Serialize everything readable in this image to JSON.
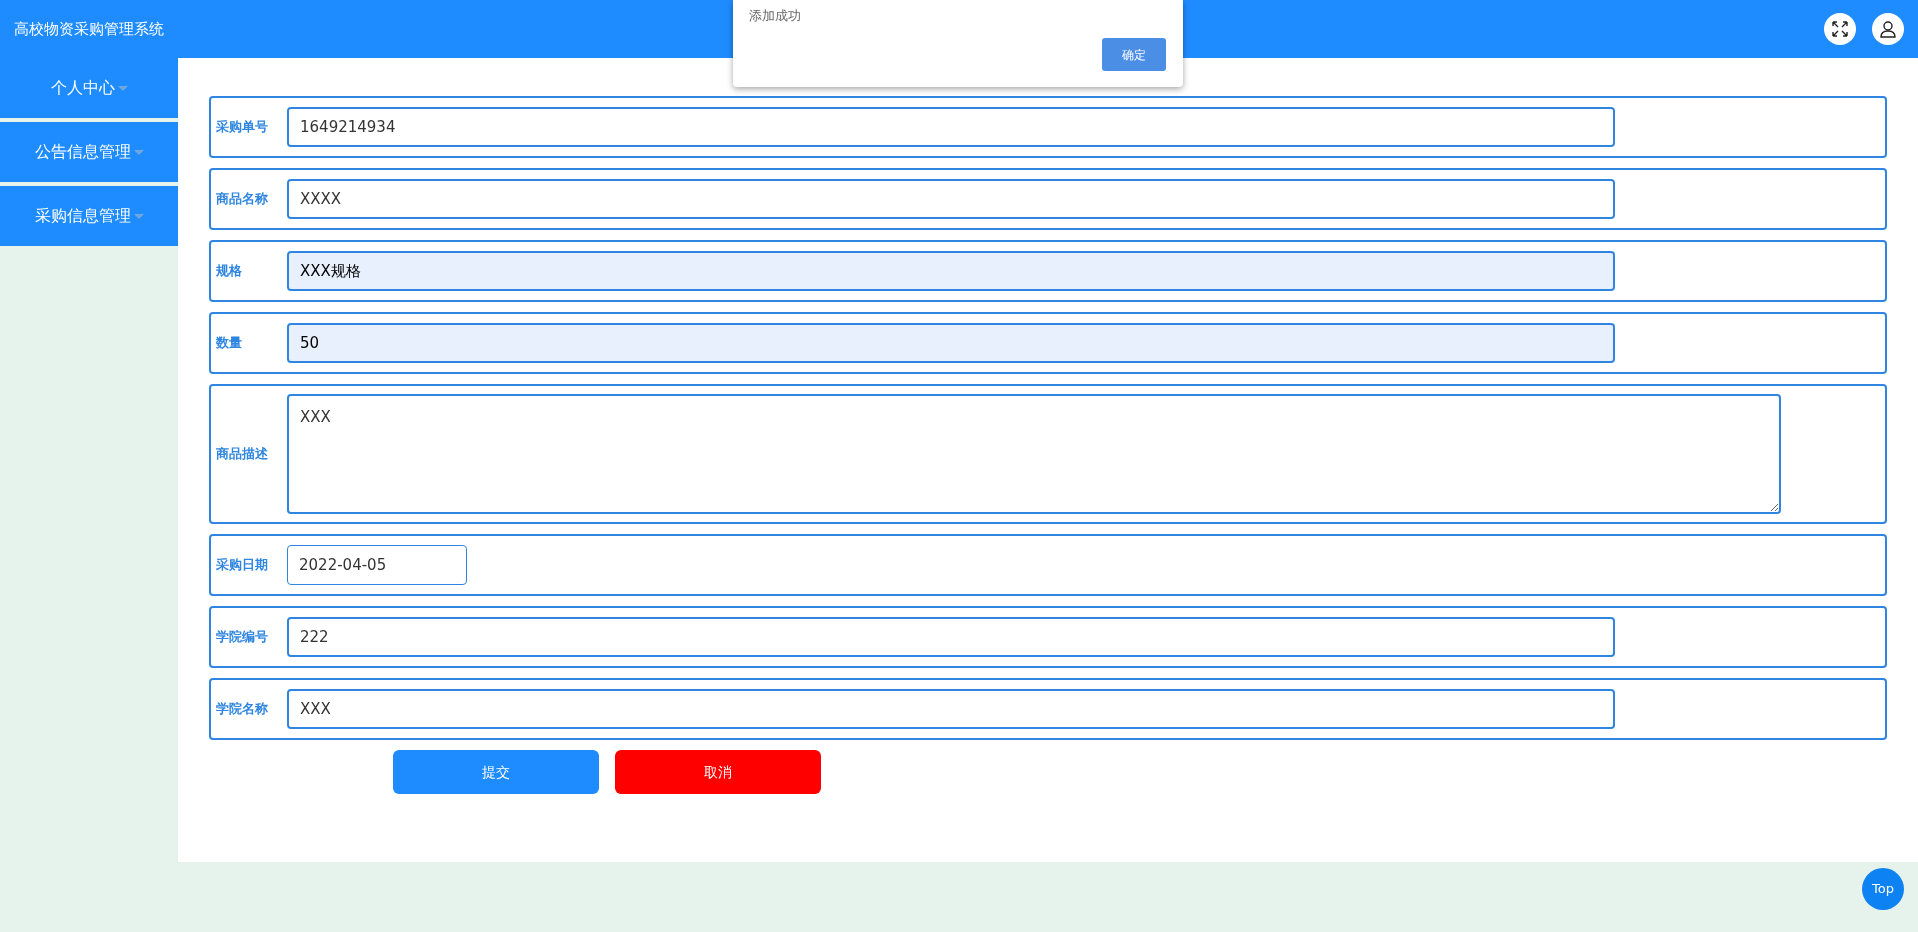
{
  "header": {
    "title": "高校物资采购管理系统"
  },
  "sidebar": {
    "items": [
      {
        "label": "个人中心",
        "expanded": false
      },
      {
        "label": "公告信息管理",
        "expanded": false
      },
      {
        "label": "采购信息管理",
        "expanded": false
      }
    ]
  },
  "form": {
    "fields": [
      {
        "kind": "input",
        "label": "采购单号",
        "value": "1649214934",
        "autofilled": false
      },
      {
        "kind": "input",
        "label": "商品名称",
        "value": "XXXX",
        "autofilled": false
      },
      {
        "kind": "input",
        "label": "规格",
        "value": "XXX规格",
        "autofilled": true
      },
      {
        "kind": "input",
        "label": "数量",
        "value": "50",
        "autofilled": true
      },
      {
        "kind": "textarea",
        "label": "商品描述",
        "value": "XXX",
        "autofilled": false
      },
      {
        "kind": "date",
        "label": "采购日期",
        "value": "2022-04-05",
        "autofilled": false
      },
      {
        "kind": "input",
        "label": "学院编号",
        "value": "222",
        "autofilled": false
      },
      {
        "kind": "input",
        "label": "学院名称",
        "value": "XXX",
        "autofilled": false
      }
    ],
    "buttons": [
      {
        "kind": "submit",
        "label": "提交"
      },
      {
        "kind": "cancel",
        "label": "取消"
      }
    ]
  },
  "dialog": {
    "message": "添加成功",
    "button": "确定"
  },
  "top_button": {
    "label": "Top"
  }
}
